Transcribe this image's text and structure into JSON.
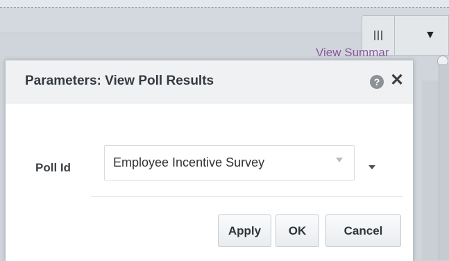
{
  "background": {
    "link_text": "View Summar",
    "menu_arrow": "▼"
  },
  "dialog": {
    "title": "Parameters: View Poll Results",
    "help_glyph": "?",
    "close_glyph": "✕",
    "field_label": "Poll Id",
    "field_value": "Employee Incentive Survey",
    "buttons": {
      "apply": "Apply",
      "ok": "OK",
      "cancel": "Cancel"
    }
  },
  "colors": {
    "link": "#8a5a9c",
    "header_bg": "#f0f1f3",
    "help_icon": "#8c9196"
  }
}
